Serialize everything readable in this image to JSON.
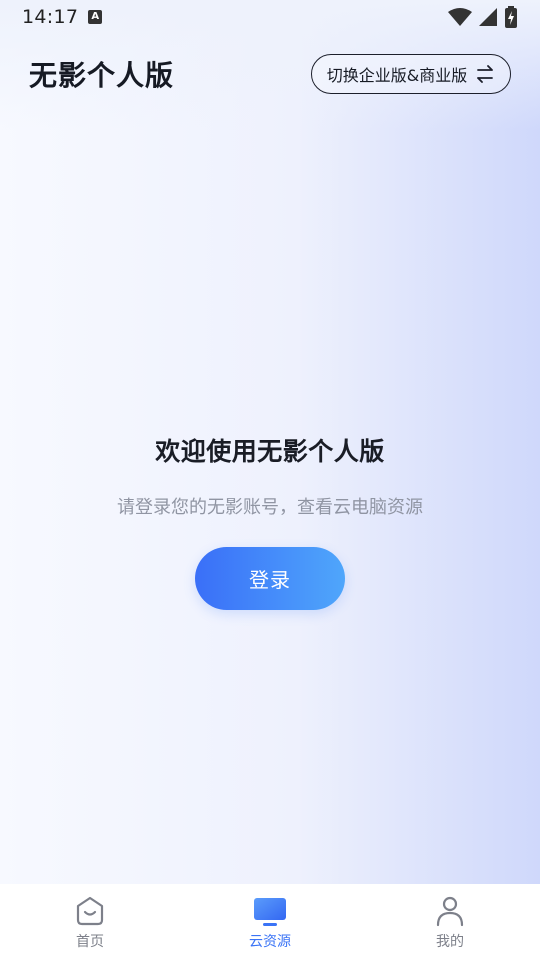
{
  "status_bar": {
    "time": "14:17",
    "notification_badge": "A"
  },
  "header": {
    "title": "无影个人版",
    "switch_label": "切换企业版&商业版"
  },
  "main": {
    "welcome_title": "欢迎使用无影个人版",
    "welcome_subtitle": "请登录您的无影账号，查看云电脑资源",
    "login_label": "登录"
  },
  "bottom_nav": {
    "items": [
      {
        "label": "首页",
        "icon": "home-icon",
        "active": false
      },
      {
        "label": "云资源",
        "icon": "monitor-icon",
        "active": true
      },
      {
        "label": "我的",
        "icon": "user-icon",
        "active": false
      }
    ]
  },
  "colors": {
    "accent": "#3b74f6",
    "login_gradient_start": "#3a6ff8",
    "login_gradient_end": "#4fa6fb"
  }
}
